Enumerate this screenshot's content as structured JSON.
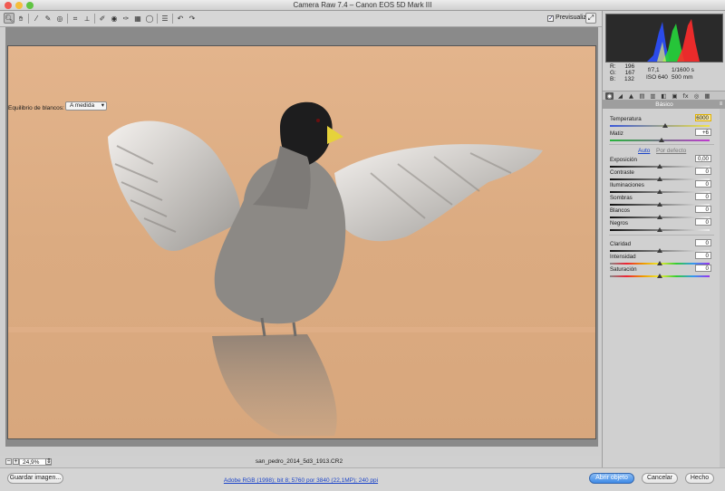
{
  "window": {
    "title": "Camera Raw 7.4  –  Canon EOS 5D Mark III"
  },
  "toolbar": {
    "tools": [
      {
        "name": "zoom-tool-icon",
        "glyph": "🔍︎"
      },
      {
        "name": "hand-tool-icon",
        "glyph": "✋︎"
      },
      {
        "name": "white-balance-tool-icon",
        "glyph": "⁄"
      },
      {
        "name": "color-sampler-icon",
        "glyph": "✎"
      },
      {
        "name": "target-adjust-icon",
        "glyph": "◎"
      },
      {
        "name": "crop-tool-icon",
        "glyph": "⌗"
      },
      {
        "name": "straighten-tool-icon",
        "glyph": "⟂"
      },
      {
        "name": "spot-removal-icon",
        "glyph": "✐"
      },
      {
        "name": "red-eye-icon",
        "glyph": "◉"
      },
      {
        "name": "adjustment-brush-icon",
        "glyph": "✑"
      },
      {
        "name": "graduated-filter-icon",
        "glyph": "▦"
      },
      {
        "name": "radial-filter-icon",
        "glyph": "◯"
      },
      {
        "name": "preferences-icon",
        "glyph": "☰"
      },
      {
        "name": "rotate-left-icon",
        "glyph": "↶"
      },
      {
        "name": "rotate-right-icon",
        "glyph": "↷"
      }
    ],
    "preview_label": "Previsualizar",
    "preview_checked": true
  },
  "status": {
    "zoom": "24,9%",
    "filename": "san_pedro_2014_5d3_1913.CR2"
  },
  "panel": {
    "rgb": {
      "r_label": "R:",
      "r": "196",
      "g_label": "G:",
      "g": "167",
      "b_label": "B:",
      "b": "132"
    },
    "exif": {
      "aperture": "f/7,1",
      "shutter": "1/1600 s",
      "iso": "ISO 640",
      "focal": "500 mm"
    },
    "section_title": "Básico",
    "wb_label": "Equilibrio de blancos:",
    "wb_value": "A medida",
    "auto_label": "Auto",
    "default_label": "Por defecto",
    "sliders": {
      "temperature": {
        "label": "Temperatura",
        "value": "6000",
        "pos": 0.55
      },
      "tint": {
        "label": "Matiz",
        "value": "+6",
        "pos": 0.52
      },
      "exposure": {
        "label": "Exposición",
        "value": "0,00",
        "pos": 0.5
      },
      "contrast": {
        "label": "Contraste",
        "value": "0",
        "pos": 0.5
      },
      "highlights": {
        "label": "Iluminaciones",
        "value": "0",
        "pos": 0.5
      },
      "shadows": {
        "label": "Sombras",
        "value": "0",
        "pos": 0.5
      },
      "whites": {
        "label": "Blancos",
        "value": "0",
        "pos": 0.5
      },
      "blacks": {
        "label": "Negros",
        "value": "0",
        "pos": 0.5
      },
      "clarity": {
        "label": "Claridad",
        "value": "0",
        "pos": 0.5
      },
      "vibrance": {
        "label": "Intensidad",
        "value": "0",
        "pos": 0.5
      },
      "saturation": {
        "label": "Saturación",
        "value": "0",
        "pos": 0.5
      }
    }
  },
  "bottom": {
    "save_label": "Guardar imagen...",
    "workflow_label": "Adobe RGB (1998); bit 8; 5760 por 3840 (22,1MP); 240 ppi",
    "open_label": "Abrir objeto",
    "cancel_label": "Cancelar",
    "done_label": "Hecho"
  },
  "colors": {
    "accent": "#3f8ae6",
    "photo_bg": "#d9a880",
    "link": "#1a43c8"
  }
}
